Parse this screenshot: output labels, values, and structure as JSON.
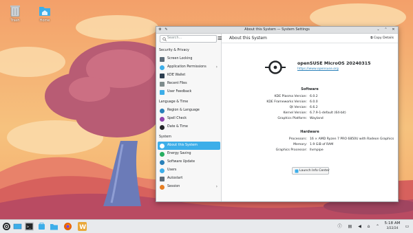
{
  "desktop": {
    "icons": [
      {
        "label": "Trash",
        "icon": "trash-icon"
      },
      {
        "label": "Home",
        "icon": "home-folder-icon"
      }
    ]
  },
  "window": {
    "title": "About this System — System Settings",
    "search_placeholder": "Search…",
    "sidebar": {
      "sections": [
        {
          "heading": "Security & Privacy",
          "items": [
            {
              "label": "Screen Locking",
              "icon": "screen-lock-icon",
              "color": "#5c6b78"
            },
            {
              "label": "Application Permissions",
              "icon": "shield-icon",
              "color": "#3daee9",
              "chevron": true
            },
            {
              "label": "KDE Wallet",
              "icon": "wallet-icon",
              "color": "#2c3e50"
            },
            {
              "label": "Recent Files",
              "icon": "recent-files-icon",
              "color": "#7f8c8d"
            },
            {
              "label": "User Feedback",
              "icon": "feedback-icon",
              "color": "#3daee9"
            }
          ]
        },
        {
          "heading": "Language & Time",
          "items": [
            {
              "label": "Region & Language",
              "icon": "globe-icon",
              "color": "#2980b9"
            },
            {
              "label": "Spell Check",
              "icon": "spell-check-icon",
              "color": "#8e44ad"
            },
            {
              "label": "Date & Time",
              "icon": "clock-icon",
              "color": "#232629"
            }
          ]
        },
        {
          "heading": "System",
          "items": [
            {
              "label": "About this System",
              "icon": "info-icon",
              "color": "#ffffff",
              "active": true
            },
            {
              "label": "Energy Saving",
              "icon": "energy-icon",
              "color": "#27ae60"
            },
            {
              "label": "Software Update",
              "icon": "update-icon",
              "color": "#2980b9"
            },
            {
              "label": "Users",
              "icon": "users-icon",
              "color": "#3daee9"
            },
            {
              "label": "Autostart",
              "icon": "autostart-icon",
              "color": "#5c6b78"
            },
            {
              "label": "Session",
              "icon": "session-icon",
              "color": "#e67e22",
              "chevron": true
            }
          ]
        }
      ]
    },
    "main": {
      "heading": "About this System",
      "copy_button": "Copy Details",
      "os_name": "openSUSE MicroOS 20240315",
      "os_url": "https://www.opensuse.org",
      "software_heading": "Software",
      "software": [
        {
          "key": "KDE Plasma Version:",
          "value": "6.0.2"
        },
        {
          "key": "KDE Frameworks Version:",
          "value": "6.0.0"
        },
        {
          "key": "Qt Version:",
          "value": "6.6.2"
        },
        {
          "key": "Kernel Version:",
          "value": "6.7.9-1-default (64-bit)"
        },
        {
          "key": "Graphics Platform:",
          "value": "Wayland"
        }
      ],
      "hardware_heading": "Hardware",
      "hardware": [
        {
          "key": "Processors:",
          "value": "16 × AMD Ryzen 7 PRO 6850U with Radeon Graphics"
        },
        {
          "key": "Memory:",
          "value": "1.9 GiB of RAM"
        },
        {
          "key": "Graphics Processor:",
          "value": "llvmpipe"
        }
      ],
      "launch_button": "Launch Info Center"
    }
  },
  "taskbar": {
    "apps": [
      "app-launcher-icon",
      "pager-icon",
      "terminal-icon",
      "discover-store-icon",
      "file-manager-icon",
      "firefox-icon",
      "app-w-icon"
    ],
    "time": "5:18 AM",
    "date": "3/22/24"
  }
}
